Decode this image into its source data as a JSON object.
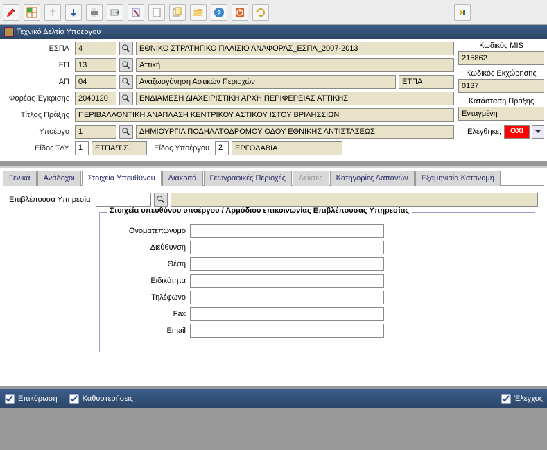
{
  "window": {
    "title": "Τεχνικό Δελτίο Υποέργου"
  },
  "toolbar_icons": [
    "pencil-red",
    "grid",
    "upload",
    "download",
    "print",
    "export",
    "note",
    "page",
    "page-copy",
    "folder-open",
    "help",
    "power",
    "refresh"
  ],
  "form": {
    "espa": {
      "label": "ΕΣΠΑ",
      "code": "4",
      "desc": "ΕΘΝΙΚΟ ΣΤΡΑΤΗΓΙΚΟ ΠΛΑΙΣΙΟ ΑΝΑΦΟΡΑΣ_ΕΣΠΑ_2007-2013"
    },
    "ep": {
      "label": "ΕΠ",
      "code": "13",
      "desc": "Αττική"
    },
    "ap": {
      "label": "ΑΠ",
      "code": "04",
      "desc": "Αναζωογόνηση Αστικών Περιοχών",
      "fund": "ΕΤΠΑ"
    },
    "foreas": {
      "label": "Φορέας Έγκρισης",
      "code": "2040120",
      "desc": "ΕΝΔΙΑΜΕΣΗ ΔΙΑΧΕΙΡΙΣΤΙΚΗ ΑΡΧΗ ΠΕΡΙΦΕΡΕΙΑΣ ΑΤΤΙΚΗΣ"
    },
    "title": {
      "label": "Τίτλος Πράξης",
      "value": "ΠΕΡΙΒΑΛΛΟΝΤΙΚΗ ΑΝΑΠΛΑΣΗ ΚΕΝΤΡΙΚΟΥ ΑΣΤΙΚΟΥ ΙΣΤΟΥ ΒΡΙΛΗΣΣΙΩΝ"
    },
    "ypoergo": {
      "label": "Υποέργο",
      "code": "1",
      "desc": "ΔΗΜΙΟΥΡΓΙΑ ΠΟΔΗΛΑΤΟΔΡΟΜΟΥ ΟΔΟΥ ΕΘΝΙΚΗΣ ΑΝΤΙΣΤΑΣΕΩΣ"
    },
    "eidos_tdy": {
      "label": "Είδος ΤΔΥ",
      "code": "1",
      "desc": "ΕΤΠΑ/Τ.Σ."
    },
    "eidos_yp": {
      "label": "Είδος Υποέργου",
      "code": "2",
      "desc": "ΕΡΓΟΛΑΒΙΑ"
    }
  },
  "side": {
    "mis": {
      "label": "Κωδικός MIS",
      "value": "215862"
    },
    "ekx": {
      "label": "Κωδικός Εκχώρησης",
      "value": "0137"
    },
    "status": {
      "label": "Κατάσταση Πράξης",
      "value": "Ενταγμένη"
    },
    "checked": {
      "label": "Ελέγθηκε;",
      "value": "ΟΧΙ"
    }
  },
  "tabs": {
    "general": "Γενικά",
    "anadoxoi": "Ανάδοχοι",
    "stoixeia": "Στοιχεία Υπευθύνου",
    "diakrita": "Διακριτά",
    "geo": "Γεωγραφικές Περιοχές",
    "deiktes": "Δείκτες",
    "dapanes": "Κατηγορίες Δαπανών",
    "examin": "Εξαμηνιαία Κατανομή"
  },
  "panel": {
    "epivlepousa": {
      "label": "Επιβλέπουσα Υπηρεσία"
    },
    "fieldset_title": "Στοιχεία υπευθύνου υποέργου / Αρμόδιου επικοινωνίας Επιβλέπουσας Υπηρεσίας",
    "fields": {
      "name": {
        "label": "Ονοματεπώνυμο",
        "value": ""
      },
      "addr": {
        "label": "Διεύθυνση",
        "value": ""
      },
      "pos": {
        "label": "Θέση",
        "value": ""
      },
      "spec": {
        "label": "Ειδικότητα",
        "value": ""
      },
      "tel": {
        "label": "Τηλέφωνο",
        "value": ""
      },
      "fax": {
        "label": "Fax",
        "value": ""
      },
      "email": {
        "label": "Email",
        "value": ""
      }
    }
  },
  "bottom": {
    "validate": "Επικύρωση",
    "delays": "Καθυστερήσεις",
    "check": "Έλεγχος"
  }
}
